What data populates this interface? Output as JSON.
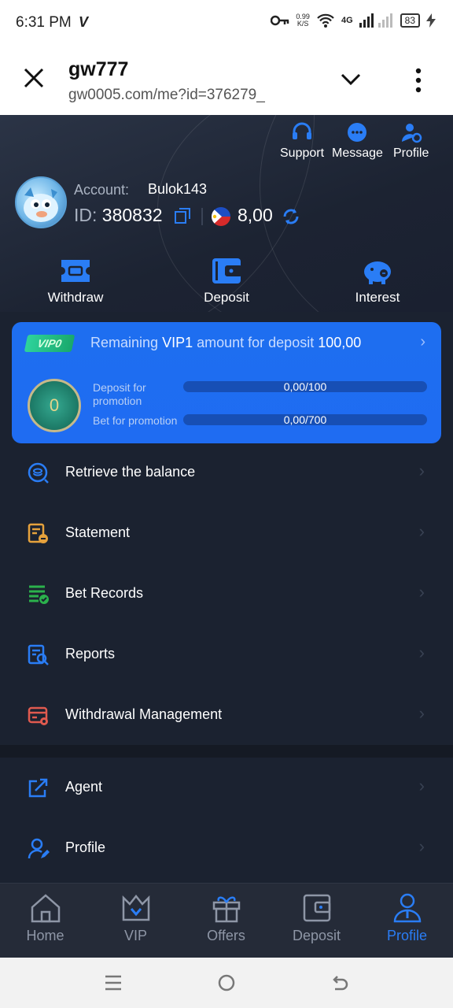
{
  "status_bar": {
    "time": "6:31 PM",
    "speed_value": "0.99",
    "speed_unit": "K/S",
    "network": "4G",
    "battery": "83"
  },
  "browser": {
    "title": "gw777",
    "url": "gw0005.com/me?id=376279_"
  },
  "top_nav": [
    {
      "label": "Support",
      "icon": "headset-icon"
    },
    {
      "label": "Message",
      "icon": "chat-icon"
    },
    {
      "label": "Profile",
      "icon": "profile-settings-icon"
    }
  ],
  "account": {
    "label": "Account:",
    "name": "Bulok143",
    "id_label": "ID:",
    "id_value": "380832",
    "balance": "8,00"
  },
  "actions": [
    {
      "label": "Withdraw",
      "icon": "ticket-icon"
    },
    {
      "label": "Deposit",
      "icon": "wallet-icon"
    },
    {
      "label": "Interest",
      "icon": "piggy-bank-icon"
    }
  ],
  "vip": {
    "badge": "VIP0",
    "text_pre": "Remaining",
    "level": "VIP1",
    "text_mid": "amount for deposit",
    "amount": "100,00",
    "medal_level": "0",
    "deposit_label": "Deposit for promotion",
    "deposit_progress": "0,00/100",
    "bet_label": "Bet for promotion",
    "bet_progress": "0,00/700"
  },
  "menu": [
    {
      "label": "Retrieve the balance",
      "icon": "refresh-coins-icon"
    },
    {
      "label": "Statement",
      "icon": "statement-icon"
    },
    {
      "label": "Bet Records",
      "icon": "bet-records-icon"
    },
    {
      "label": "Reports",
      "icon": "reports-icon"
    },
    {
      "label": "Withdrawal Management",
      "icon": "withdrawal-management-icon"
    }
  ],
  "menu2": [
    {
      "label": "Agent",
      "icon": "share-icon"
    },
    {
      "label": "Profile",
      "icon": "user-edit-icon"
    }
  ],
  "tabs": [
    {
      "label": "Home",
      "icon": "home-icon"
    },
    {
      "label": "VIP",
      "icon": "crown-icon"
    },
    {
      "label": "Offers",
      "icon": "gift-icon"
    },
    {
      "label": "Deposit",
      "icon": "wallet-icon"
    },
    {
      "label": "Profile",
      "icon": "user-icon"
    }
  ],
  "colors": {
    "accent": "#2a7df5",
    "background": "#1b2230",
    "vip_card": "#1f6cf2"
  }
}
